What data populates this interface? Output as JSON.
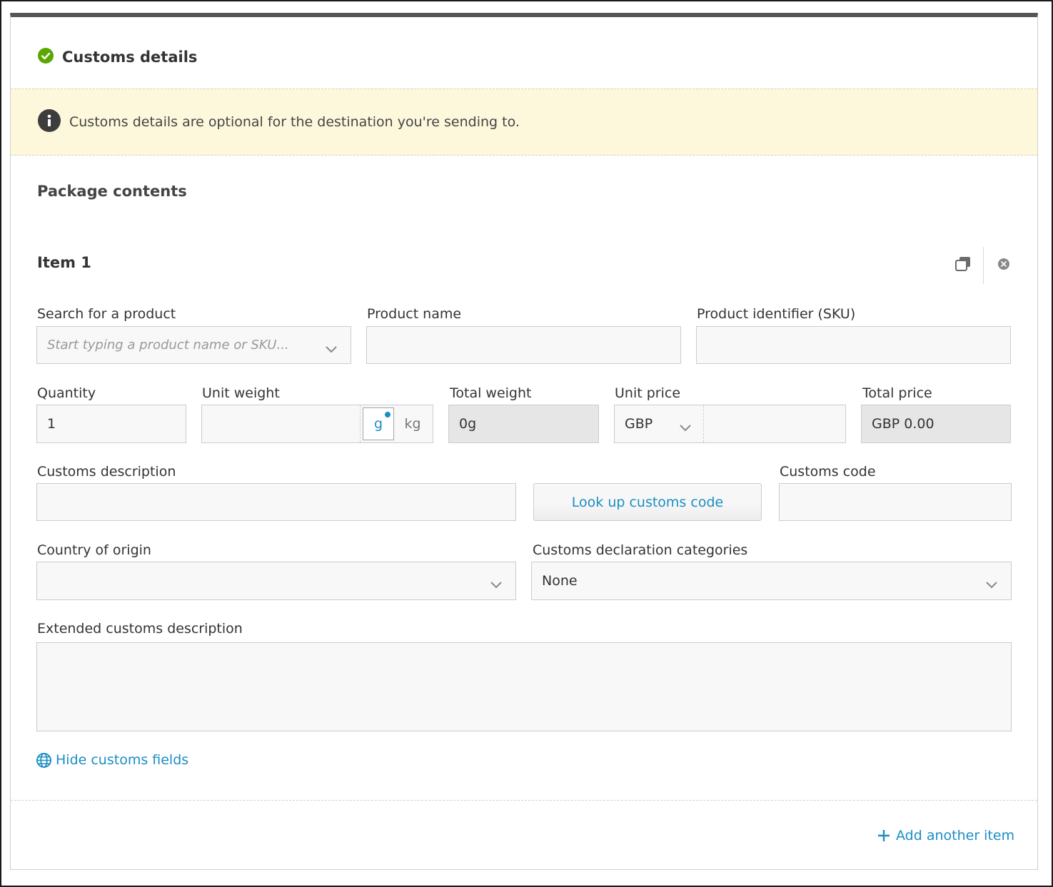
{
  "header": {
    "title": "Customs details",
    "status_icon": "check-circle-icon",
    "status_color": "#5aa700"
  },
  "notice": {
    "text": "Customs details are optional for the destination you're sending to.",
    "icon": "info-icon",
    "background": "#fdf8db"
  },
  "package": {
    "section_title": "Package contents",
    "item": {
      "title": "Item 1",
      "actions": {
        "duplicate_icon": "duplicate-icon",
        "remove_icon": "close-circle-icon"
      },
      "search": {
        "label": "Search for a product",
        "placeholder": "Start typing a product name or SKU..."
      },
      "product_name": {
        "label": "Product name",
        "value": ""
      },
      "sku": {
        "label": "Product identifier (SKU)",
        "value": ""
      },
      "quantity": {
        "label": "Quantity",
        "value": "1"
      },
      "unit_weight": {
        "label": "Unit weight",
        "value": "",
        "unit_g": "g",
        "unit_kg": "kg",
        "selected_unit": "g"
      },
      "total_weight": {
        "label": "Total weight",
        "value": "0g"
      },
      "unit_price": {
        "label": "Unit price",
        "currency": "GBP",
        "value": ""
      },
      "total_price": {
        "label": "Total price",
        "value": "GBP 0.00"
      },
      "customs_description": {
        "label": "Customs description",
        "value": ""
      },
      "lookup_button": "Look up customs code",
      "customs_code": {
        "label": "Customs code",
        "value": ""
      },
      "country_of_origin": {
        "label": "Country of origin",
        "value": ""
      },
      "declaration_categories": {
        "label": "Customs declaration categories",
        "value": "None"
      },
      "extended_description": {
        "label": "Extended customs description",
        "value": ""
      },
      "hide_link": "Hide customs fields"
    },
    "add_item": "Add another item"
  },
  "colors": {
    "accent": "#1b8dc5",
    "readonly_bg": "#e6e6e6",
    "field_bg": "#f8f8f8"
  }
}
